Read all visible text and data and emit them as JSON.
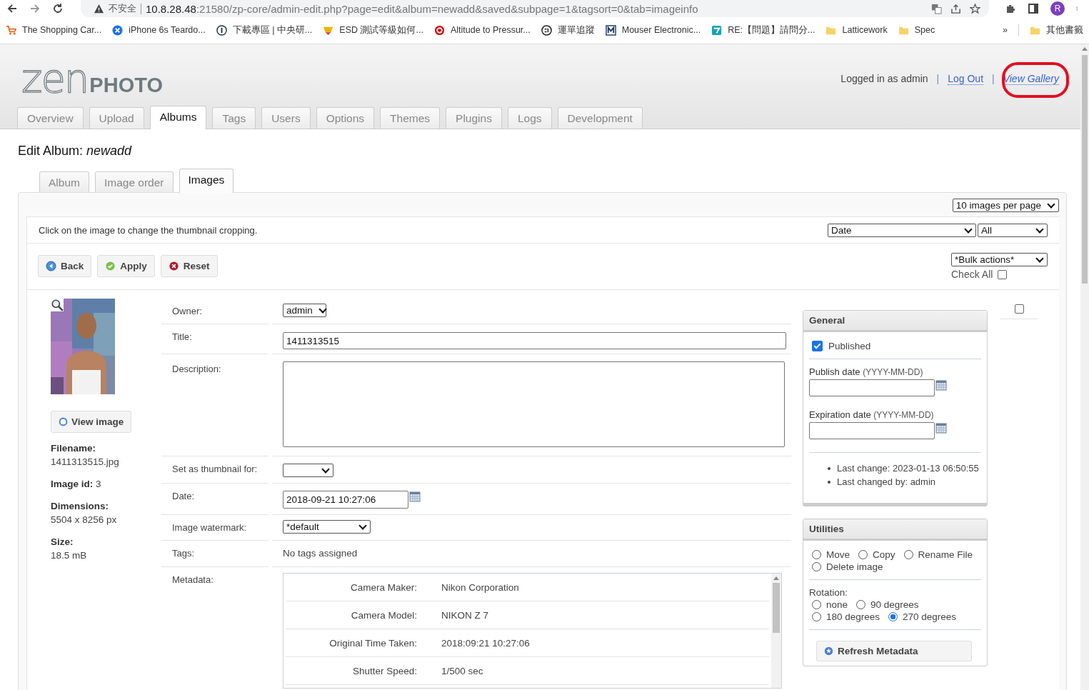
{
  "browser": {
    "security": "不安全",
    "url_host": "10.8.28.48",
    "url_rest": ":21580/zp-core/admin-edit.php?page=edit&album=newadd&saved&subpage=1&tagsort=0&tab=imageinfo",
    "profile": "R",
    "bookmarks": [
      {
        "label": "The Shopping Car...",
        "kind": "cart"
      },
      {
        "label": "iPhone 6s Teardo...",
        "kind": "cross"
      },
      {
        "label": "下載專區 | 中央研...",
        "kind": "info"
      },
      {
        "label": "ESD 測試等級如何...",
        "kind": "shield"
      },
      {
        "label": "Altitude to Pressur...",
        "kind": "target"
      },
      {
        "label": "運單追蹤",
        "kind": "sf"
      },
      {
        "label": "Mouser Electronic...",
        "kind": "m"
      },
      {
        "label": "RE:【問題】請問分...",
        "kind": "ticket"
      },
      {
        "label": "Latticework",
        "kind": "folder"
      },
      {
        "label": "Spec",
        "kind": "folder"
      }
    ],
    "overflow": "»",
    "other_bookmarks": "其他書籤"
  },
  "header": {
    "logo_thin": "zen",
    "logo_bold": "PHOTO",
    "logged_in": "Logged in as admin",
    "separator": "|",
    "links": [
      {
        "label": "Log Out",
        "italic": false
      },
      {
        "label": "View Gallery",
        "italic": true
      }
    ],
    "annotation_circle": true
  },
  "tabs": [
    {
      "label": "Overview",
      "selected": false
    },
    {
      "label": "Upload",
      "selected": false
    },
    {
      "label": "Albums",
      "selected": true
    },
    {
      "label": "Tags",
      "selected": false
    },
    {
      "label": "Users",
      "selected": false
    },
    {
      "label": "Options",
      "selected": false
    },
    {
      "label": "Themes",
      "selected": false
    },
    {
      "label": "Plugins",
      "selected": false
    },
    {
      "label": "Logs",
      "selected": false
    },
    {
      "label": "Development",
      "selected": false
    }
  ],
  "page_title": "Edit Album:",
  "album_name": "newadd",
  "subtabs": [
    {
      "label": "Album",
      "selected": false
    },
    {
      "label": "Image order",
      "selected": false
    },
    {
      "label": "Images",
      "selected": true
    }
  ],
  "per_page": "10 images per page",
  "note": "Click on the image to change the thumbnail cropping.",
  "sort": "Date",
  "filter": "All",
  "buttons": [
    {
      "label": "Back",
      "kind": "back"
    },
    {
      "label": "Apply",
      "kind": "apply"
    },
    {
      "label": "Reset",
      "kind": "reset"
    }
  ],
  "bulk": "*Bulk actions*",
  "check_all": {
    "label": "Check All",
    "checked": false
  },
  "image": {
    "view_button": "View image",
    "info": [
      {
        "label": "Filename:",
        "value": "1411313515.jpg",
        "kind": "stacked"
      },
      {
        "label": "Image id:",
        "value": "3",
        "kind": "inline"
      },
      {
        "label": "Dimensions:",
        "value": "5504 x 8256 px",
        "kind": "stacked"
      },
      {
        "label": "Size:",
        "value": "18.5 mB",
        "kind": "stacked"
      }
    ],
    "selected": false
  },
  "form": [
    {
      "label": "Owner:",
      "kind": "select",
      "value": "admin"
    },
    {
      "label": "Title:",
      "kind": "input",
      "value": "1411313515"
    },
    {
      "label": "Description:",
      "kind": "textarea"
    },
    {
      "label": "Set as thumbnail for:",
      "kind": "select_empty"
    },
    {
      "label": "Date:",
      "kind": "date",
      "value": "2018-09-21 10:27:06"
    },
    {
      "label": "Image watermark:",
      "kind": "select_wide",
      "value": "*default"
    },
    {
      "label": "Tags:",
      "kind": "text",
      "value": "No tags assigned"
    },
    {
      "label": "Metadata:",
      "kind": "metadata",
      "rows": [
        {
          "label": "Camera Maker:",
          "value": "Nikon Corporation"
        },
        {
          "label": "Camera Model:",
          "value": "NIKON Z 7"
        },
        {
          "label": "Original Time Taken:",
          "value": "2018:09:21 10:27:06"
        },
        {
          "label": "Shutter Speed:",
          "value": "1/500 sec"
        }
      ]
    }
  ],
  "general": {
    "title": "General",
    "published": {
      "label": "Published",
      "checked": true
    },
    "publish_date": {
      "label": "Publish date",
      "hint": "(YYYY-MM-DD)"
    },
    "expiration_date": {
      "label": "Expiration date",
      "hint": "(YYYY-MM-DD)"
    },
    "changes": [
      "Last change: 2023-01-13 06:50:55",
      "Last changed by: admin"
    ]
  },
  "utilities": {
    "title": "Utilities",
    "actions": [
      {
        "label": "Move",
        "selected": false
      },
      {
        "label": "Copy",
        "selected": false
      },
      {
        "label": "Rename File",
        "selected": false
      },
      {
        "label": "Delete image",
        "selected": false
      }
    ],
    "rotation_label": "Rotation:",
    "rotation": [
      {
        "label": "none",
        "selected": false
      },
      {
        "label": "90 degrees",
        "selected": false
      },
      {
        "label": "180 degrees",
        "selected": false
      },
      {
        "label": "270 degrees",
        "selected": true
      }
    ],
    "refresh_button": "Refresh Metadata"
  }
}
